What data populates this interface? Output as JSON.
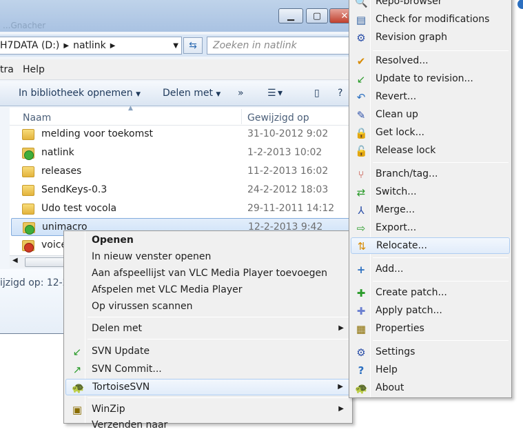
{
  "explorer": {
    "ghost_title": "...Gnacher",
    "address": {
      "segments": [
        "H7DATA (D:)",
        "natlink"
      ]
    },
    "search_placeholder": "Zoeken in natlink",
    "menu": [
      "tra",
      "Help"
    ],
    "toolbar": {
      "include_library": "In bibliotheek opnemen",
      "share_with": "Delen met",
      "more": "»"
    },
    "columns": {
      "name": "Naam",
      "modified": "Gewijzigd op"
    },
    "files": [
      {
        "name": "melding voor toekomst",
        "date": "31-10-2012 9:02",
        "icon": "folder-icon"
      },
      {
        "name": "natlink",
        "date": "1-2-2013 10:02",
        "icon": "svn-ok-folder-icon"
      },
      {
        "name": "releases",
        "date": "11-2-2013 16:02",
        "icon": "folder-icon"
      },
      {
        "name": "SendKeys-0.3",
        "date": "24-2-2012 18:03",
        "icon": "folder-icon"
      },
      {
        "name": "Udo test vocola",
        "date": "29-11-2011 14:12",
        "icon": "folder-icon"
      },
      {
        "name": "unimacro",
        "date": "12-2-2013 9:42",
        "icon": "svn-ok-folder-icon",
        "selected": true
      },
      {
        "name": "voice",
        "date": "",
        "icon": "svn-modified-folder-icon"
      }
    ],
    "details": "ijzigd op: 12-2"
  },
  "context_menu": {
    "items": [
      {
        "label": "Openen",
        "bold": true
      },
      {
        "label": "In nieuw venster openen"
      },
      {
        "label": "Aan afspeellijst van VLC Media Player toevoegen"
      },
      {
        "label": "Afspelen met VLC Media Player"
      },
      {
        "label": "Op virussen scannen"
      },
      {
        "label": "Delen met",
        "submenu": true
      },
      {
        "label": "SVN Update",
        "icon": "svn-update-icon"
      },
      {
        "label": "SVN Commit...",
        "icon": "svn-commit-icon"
      },
      {
        "label": "TortoiseSVN",
        "icon": "tortoise-icon",
        "submenu": true
      },
      {
        "label": "WinZip",
        "icon": "winzip-icon",
        "submenu": true
      },
      {
        "label": "Verzenden naar"
      }
    ]
  },
  "submenu": {
    "items": [
      {
        "label": "Repo-browser",
        "icon": "repo-browser-icon"
      },
      {
        "label": "Check for modifications",
        "icon": "check-modifications-icon"
      },
      {
        "label": "Revision graph",
        "icon": "revision-graph-icon"
      },
      {
        "label": "Resolved...",
        "icon": "resolved-icon"
      },
      {
        "label": "Update to revision...",
        "icon": "update-revision-icon"
      },
      {
        "label": "Revert...",
        "icon": "revert-icon"
      },
      {
        "label": "Clean up",
        "icon": "cleanup-icon"
      },
      {
        "label": "Get lock...",
        "icon": "lock-icon"
      },
      {
        "label": "Release lock",
        "icon": "unlock-icon"
      },
      {
        "label": "Branch/tag...",
        "icon": "branch-icon"
      },
      {
        "label": "Switch...",
        "icon": "switch-icon"
      },
      {
        "label": "Merge...",
        "icon": "merge-icon"
      },
      {
        "label": "Export...",
        "icon": "export-icon"
      },
      {
        "label": "Relocate...",
        "icon": "relocate-icon",
        "highlighted": true
      },
      {
        "label": "Add...",
        "icon": "add-icon"
      },
      {
        "label": "Create patch...",
        "icon": "create-patch-icon"
      },
      {
        "label": "Apply patch...",
        "icon": "apply-patch-icon"
      },
      {
        "label": "Properties",
        "icon": "properties-icon"
      },
      {
        "label": "Settings",
        "icon": "settings-icon"
      },
      {
        "label": "Help",
        "icon": "help-icon"
      },
      {
        "label": "About",
        "icon": "about-icon"
      }
    ]
  }
}
